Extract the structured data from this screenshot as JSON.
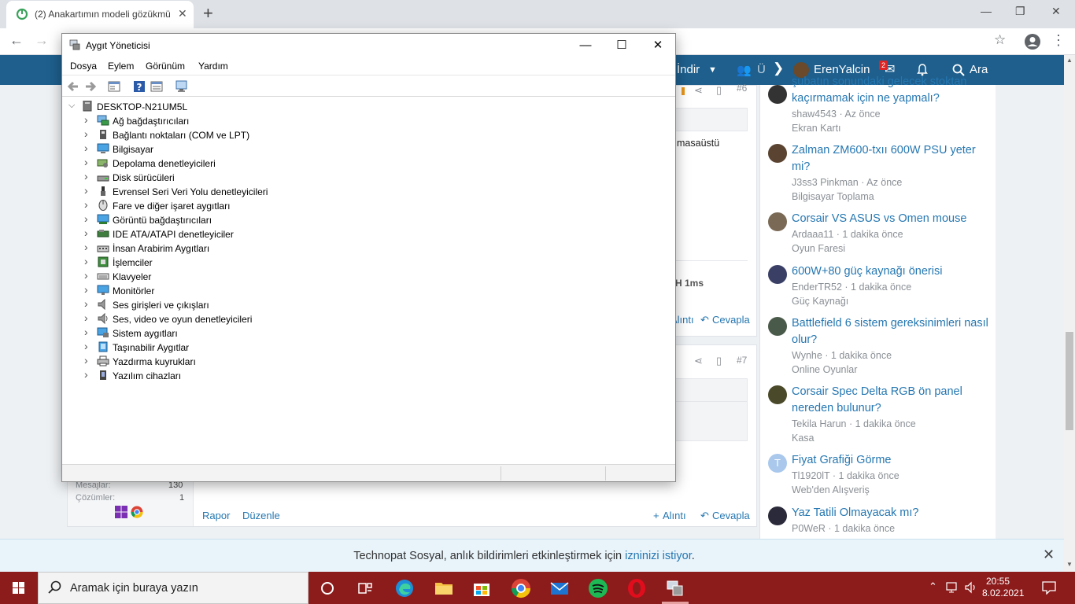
{
  "browser": {
    "tab_title": "(2) Anakartımın modeli gözükmü",
    "window_controls": [
      "minimize-icon",
      "restore-icon",
      "close-icon"
    ]
  },
  "site_nav": {
    "download": "İndir",
    "members_partial": "Ü",
    "username": "ErenYalcin",
    "inbox_badge": "2",
    "search": "Ara"
  },
  "posts": {
    "post6": {
      "number": "#6",
      "text_partial": "masaüstü",
      "sig_partial": "H 1ms",
      "quote": "Alıntı",
      "reply": "Cevapla"
    },
    "post7": {
      "number": "#7",
      "messages_label": "Mesajlar:",
      "messages_value": "130",
      "solutions_label": "Çözümler:",
      "solutions_value": "1",
      "report": "Rapor",
      "edit": "Düzenle",
      "quote": "Alıntı",
      "reply": "Cevapla"
    }
  },
  "sidebar": {
    "threads": [
      {
        "title": "şubatın sonundaki gelecek stoktan kaçırmamak için ne yapmalı?",
        "meta": "shaw4543 · Az önce",
        "forum": "Ekran Kartı"
      },
      {
        "title": "Zalman ZM600-txıı 600W PSU yeter mi?",
        "meta": "J3ss3 Pinkman · Az önce",
        "forum": "Bilgisayar Toplama"
      },
      {
        "title": "Corsair VS ASUS vs Omen mouse",
        "meta": "Ardaaa11 · 1 dakika önce",
        "forum": "Oyun Faresi"
      },
      {
        "title": "600W+80 güç kaynağı önerisi",
        "meta": "EnderTR52 · 1 dakika önce",
        "forum": "Güç Kaynağı"
      },
      {
        "title": "Battlefield 6 sistem gereksinimleri nasıl olur?",
        "meta": "Wynhe · 1 dakika önce",
        "forum": "Online Oyunlar"
      },
      {
        "title": "Corsair Spec Delta RGB ön panel nereden bulunur?",
        "meta": "Tekila Harun · 1 dakika önce",
        "forum": "Kasa"
      },
      {
        "title": "Fiyat Grafiği Görme",
        "meta": "Tl1920lT · 1 dakika önce",
        "forum": "Web'den Alışveriş",
        "avatar_letter": "T"
      },
      {
        "title": "Yaz Tatili Olmayacak mı?",
        "meta": "P0WeR · 1 dakika önce",
        "forum": ""
      }
    ]
  },
  "notification": {
    "text": "Technopat Sosyal, anlık bildirimleri etkinleştirmek için",
    "link": "izninizi istiyor",
    "end": "."
  },
  "device_manager": {
    "title": "Aygıt Yöneticisi",
    "menu": [
      "Dosya",
      "Eylem",
      "Görünüm",
      "Yardım"
    ],
    "root": "DESKTOP-N21UM5L",
    "categories": [
      "Ağ bağdaştırıcıları",
      "Bağlantı noktaları (COM ve LPT)",
      "Bilgisayar",
      "Depolama denetleyicileri",
      "Disk sürücüleri",
      "Evrensel Seri Veri Yolu denetleyicileri",
      "Fare ve diğer işaret aygıtları",
      "Görüntü bağdaştırıcıları",
      "IDE ATA/ATAPI denetleyiciler",
      "İnsan Arabirim Aygıtları",
      "İşlemciler",
      "Klavyeler",
      "Monitörler",
      "Ses girişleri ve çıkışları",
      "Ses, video ve oyun denetleyicileri",
      "Sistem aygıtları",
      "Taşınabilir Aygıtlar",
      "Yazdırma kuyrukları",
      "Yazılım cihazları"
    ]
  },
  "taskbar": {
    "search_placeholder": "Aramak için buraya yazın",
    "time": "20:55",
    "date": "8.02.2021",
    "background_color": "#8c1c1c"
  }
}
